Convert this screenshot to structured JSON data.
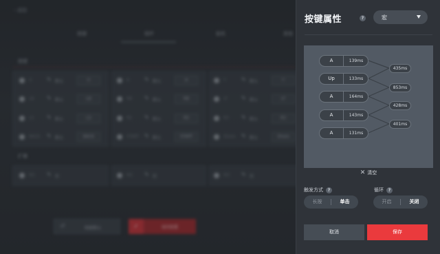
{
  "background_app": {
    "back_label": "返回",
    "tabs": [
      "按键",
      "摇杆",
      "扳机",
      "其他"
    ],
    "sections": [
      "按键",
      "扩展"
    ],
    "rows": [
      [
        {
          "name": "X",
          "text": "默认",
          "box": "X"
        },
        {
          "name": "A",
          "text": "默认",
          "box": "A"
        },
        {
          "name": "Y",
          "text": "默认",
          "box": "Y"
        }
      ],
      [
        {
          "name": "LB",
          "text": "默认",
          "box": "LB"
        },
        {
          "name": "RB",
          "text": "默认",
          "box": "RB"
        },
        {
          "name": "LT",
          "text": "默认",
          "box": "LT"
        }
      ],
      [
        {
          "name": "LS",
          "text": "默认",
          "box": "LS"
        },
        {
          "name": "RS",
          "text": "默认",
          "box": "RS"
        },
        {
          "name": "R3",
          "text": "默认",
          "box": "R3"
        }
      ],
      [
        {
          "name": "BACK",
          "text": "默认",
          "box": "BACK"
        },
        {
          "name": "START",
          "text": "默认",
          "box": "START"
        },
        {
          "name": "Share",
          "text": "默认",
          "box": "Share"
        }
      ]
    ],
    "extension_rows": [
      {
        "name": "M1",
        "text": "宏"
      },
      {
        "name": "M2",
        "text": "宏"
      },
      {
        "name": "M3",
        "text": "宏"
      }
    ],
    "reset_label": "恢复默认",
    "save_label": "保存配置"
  },
  "panel": {
    "title": "按键属性",
    "help_glyph": "?",
    "mode_value": "宏",
    "macro_steps": [
      {
        "key": "A",
        "duration": "139ms"
      },
      {
        "key": "Up",
        "duration": "133ms"
      },
      {
        "key": "A",
        "duration": "164ms"
      },
      {
        "key": "A",
        "duration": "143ms"
      },
      {
        "key": "A",
        "duration": "131ms"
      }
    ],
    "intervals": [
      "435ms",
      "853ms",
      "428ms",
      "401ms"
    ],
    "clear_label": "清空",
    "trigger": {
      "label": "触发方式",
      "options": [
        "长按",
        "单击"
      ],
      "selected": "单击"
    },
    "loop": {
      "label": "循环",
      "options": [
        "开启",
        "关闭"
      ],
      "selected": "关闭"
    },
    "cancel_label": "取消",
    "save_label": "保存",
    "accent_color": "#ea3a3d"
  }
}
